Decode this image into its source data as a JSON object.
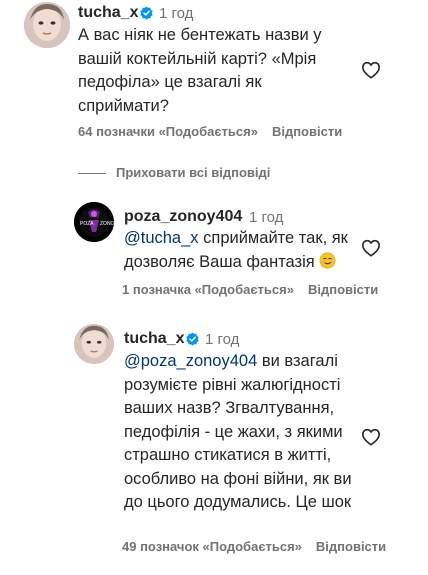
{
  "comment1": {
    "username": "tucha_x",
    "time": "1 год",
    "text": "А вас ніяк не бентежать назви у вашій коктейльній карті? «Мрія педофіла» це взагалі як сприймати?",
    "likes": "64 позначки «Подобається»",
    "reply": "Відповісти"
  },
  "hide_replies": "Приховати всі відповіді",
  "reply1": {
    "username": "poza_zonoy404",
    "time": "1 год",
    "mention": "@tucha_x",
    "text": " сприймайте так, як дозволяє Ваша фантазія",
    "likes": "1 позначка «Подобається»",
    "reply": "Відповісти"
  },
  "reply2": {
    "username": "tucha_x",
    "time": "1 год",
    "mention": "@poza_zonoy404",
    "text": " ви взагалі розумієте рівні жалюгідності ваших назв? Згвалтування, педофілія - це жахи, з якими страшно стикатися в житті, особливо на фоні війни, як ви до цього додумались. Це шок",
    "likes": "49 позначок «Подобається»",
    "reply": "Відповісти"
  },
  "colors": {
    "text": "#262626",
    "secondary": "#737373",
    "mention": "#00376b",
    "verified": "#0095f6"
  }
}
